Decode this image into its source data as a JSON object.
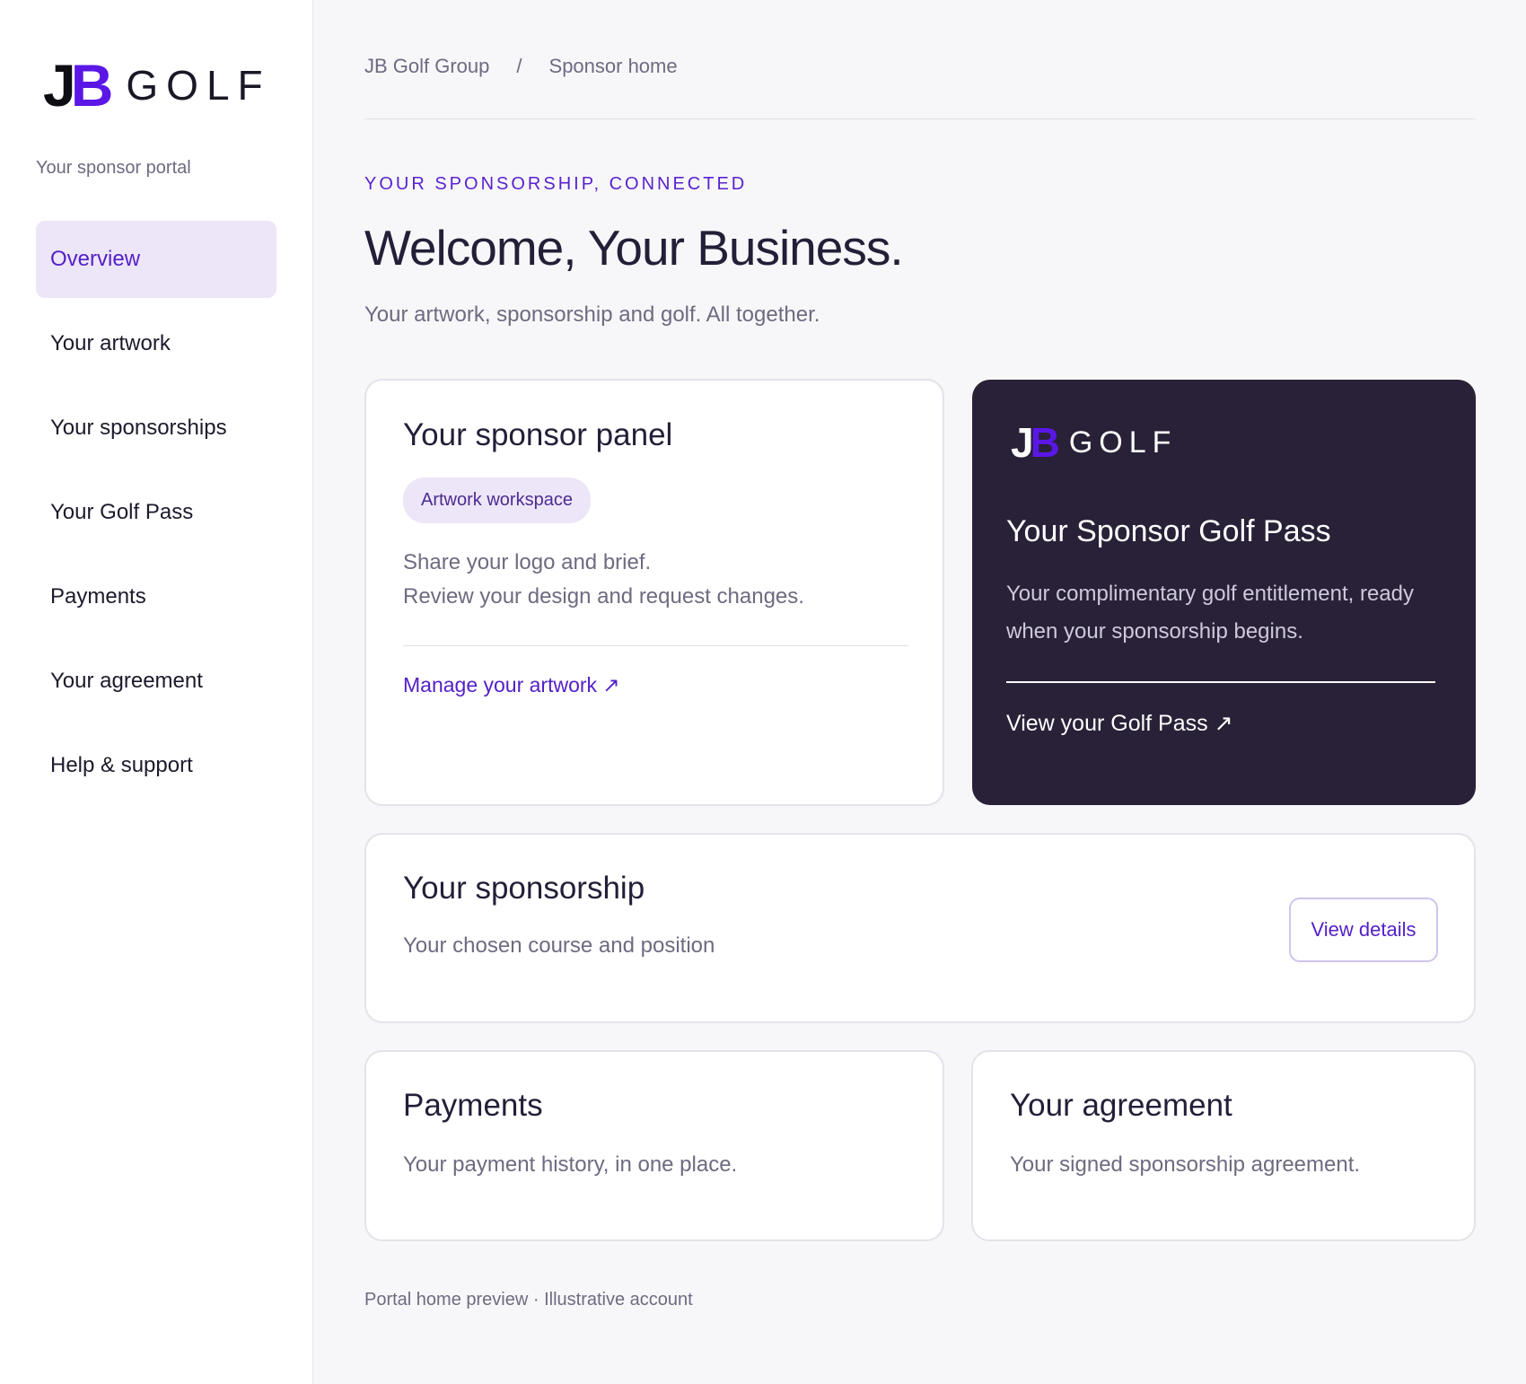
{
  "brand": {
    "logo_j": "J",
    "logo_b": "B",
    "logo_word": "GOLF",
    "accent": "#5a17e6"
  },
  "sidebar": {
    "caption": "Your sponsor portal",
    "items": [
      {
        "label": "Overview",
        "active": true
      },
      {
        "label": "Your artwork"
      },
      {
        "label": "Your sponsorships"
      },
      {
        "label": "Your Golf Pass"
      },
      {
        "label": "Payments"
      },
      {
        "label": "Your agreement"
      },
      {
        "label": "Help & support"
      }
    ]
  },
  "breadcrumb": {
    "root": "JB Golf Group",
    "separator": "/",
    "current": "Sponsor home"
  },
  "hero": {
    "eyebrow": "YOUR SPONSORSHIP, CONNECTED",
    "title": "Welcome, Your Business.",
    "subtitle": "Your artwork, sponsorship and golf. All together."
  },
  "panel": {
    "title": "Your sponsor panel",
    "chip": "Artwork workspace",
    "line1": "Share your logo and brief.",
    "line2": "Review your design and request changes.",
    "link": "Manage your artwork ↗"
  },
  "pass": {
    "title": "Your Sponsor Golf Pass",
    "description": "Your complimentary golf entitlement, ready when your sponsorship begins.",
    "link": "View your Golf Pass ↗"
  },
  "sponsorship": {
    "title": "Your sponsorship",
    "description": "Your chosen course and position",
    "button": "View details"
  },
  "payments": {
    "title": "Payments",
    "description": "Your payment history, in one place."
  },
  "agreement": {
    "title": "Your agreement",
    "description": "Your signed sponsorship agreement."
  },
  "footer": "Portal home preview · Illustrative account"
}
